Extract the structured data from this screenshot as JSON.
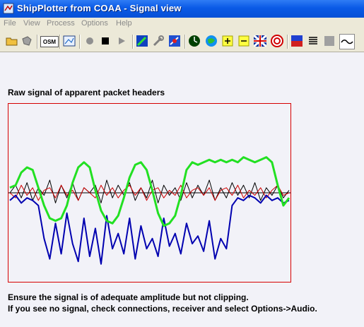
{
  "window": {
    "title": "ShipPlotter from COAA - Signal view"
  },
  "menu": [
    "File",
    "View",
    "Process",
    "Options",
    "Help"
  ],
  "toolbar": {
    "osm_label": "OSM"
  },
  "content": {
    "heading": "Raw signal of apparent packet headers",
    "note_line1": "Ensure the signal is of adequate amplitude but not clipping.",
    "note_line2": "If you see no signal, check connections, receiver and select Options->Audio."
  },
  "colors": {
    "border": "#d60000",
    "green": "#22e022",
    "blue": "#0000b0",
    "black": "#000000",
    "red": "#d00000",
    "background": "#f2f2f8"
  },
  "chart_data": {
    "type": "line",
    "title": "Raw signal of apparent packet headers",
    "series": [
      {
        "name": "",
        "color": "green",
        "values": [
          0.2,
          0.3,
          0.8,
          1.0,
          0.9,
          0.2,
          -0.5,
          -1.0,
          -1.1,
          -1.0,
          -0.5,
          0.4,
          1.0,
          1.2,
          1.0,
          0.1,
          -0.7,
          -1.1,
          -1.2,
          -0.9,
          -0.2,
          0.6,
          1.1,
          1.2,
          0.9,
          0.1,
          -0.8,
          -1.3,
          -1.2,
          -0.9,
          -0.1,
          0.9,
          1.2,
          1.1,
          1.2,
          1.3,
          1.2,
          1.3,
          1.2,
          1.3,
          1.2,
          1.4,
          1.3,
          1.2,
          1.3,
          1.4,
          1.2,
          0.3,
          -0.5,
          -0.2
        ]
      },
      {
        "name": "",
        "color": "blue",
        "values": [
          -0.3,
          -0.1,
          -0.4,
          -0.2,
          -0.3,
          -0.5,
          -1.8,
          -2.6,
          -1.2,
          -2.4,
          -0.8,
          -2.0,
          -2.7,
          -1.0,
          -2.5,
          -1.4,
          -2.8,
          -0.9,
          -2.2,
          -1.6,
          -2.4,
          -1.0,
          -2.6,
          -1.3,
          -2.2,
          -1.8,
          -2.5,
          -1.0,
          -2.1,
          -1.6,
          -2.4,
          -1.2,
          -2.0,
          -1.7,
          -2.3,
          -1.1,
          -2.6,
          -1.8,
          -2.2,
          -0.5,
          -0.2,
          -0.3,
          -0.1,
          -0.2,
          -0.4,
          -0.1,
          -0.3,
          -0.2,
          -0.4,
          -0.3
        ]
      },
      {
        "name": "",
        "color": "black",
        "values": [
          0.0,
          0.3,
          -0.2,
          0.4,
          -0.3,
          0.2,
          -0.1,
          0.5,
          -0.4,
          0.3,
          -0.2,
          0.4,
          -0.3,
          0.2,
          0.0,
          0.3,
          -0.4,
          0.5,
          -0.2,
          0.3,
          -0.1,
          0.4,
          -0.3,
          0.2,
          -0.2,
          0.5,
          -0.4,
          0.3,
          -0.1,
          0.2,
          -0.3,
          0.4,
          -0.2,
          0.3,
          -0.1,
          0.5,
          -0.3,
          0.2,
          -0.2,
          0.4,
          -0.1,
          0.3,
          -0.2,
          0.4,
          -0.3,
          0.2,
          -0.1,
          0.3,
          -0.2,
          0.1
        ]
      },
      {
        "name": "",
        "color": "red",
        "values": [
          0.0,
          -0.2,
          0.3,
          -0.1,
          0.2,
          -0.3,
          0.1,
          0.2,
          -0.2,
          0.3,
          -0.1,
          0.1,
          -0.3,
          0.2,
          0.0,
          -0.2,
          0.3,
          -0.1,
          0.2,
          -0.2,
          0.1,
          0.3,
          -0.1,
          0.2,
          -0.3,
          0.1,
          0.2,
          -0.2,
          0.1,
          -0.1,
          0.3,
          -0.2,
          0.1,
          0.2,
          -0.1,
          0.2,
          -0.3,
          0.1,
          0.2,
          -0.1,
          0.3,
          -0.2,
          0.1,
          -0.1,
          0.2,
          -0.2,
          0.1,
          0.3,
          -0.1,
          0.0
        ]
      }
    ],
    "ylim": [
      -3.5,
      3.5
    ],
    "baseline": 0,
    "grid": false
  }
}
